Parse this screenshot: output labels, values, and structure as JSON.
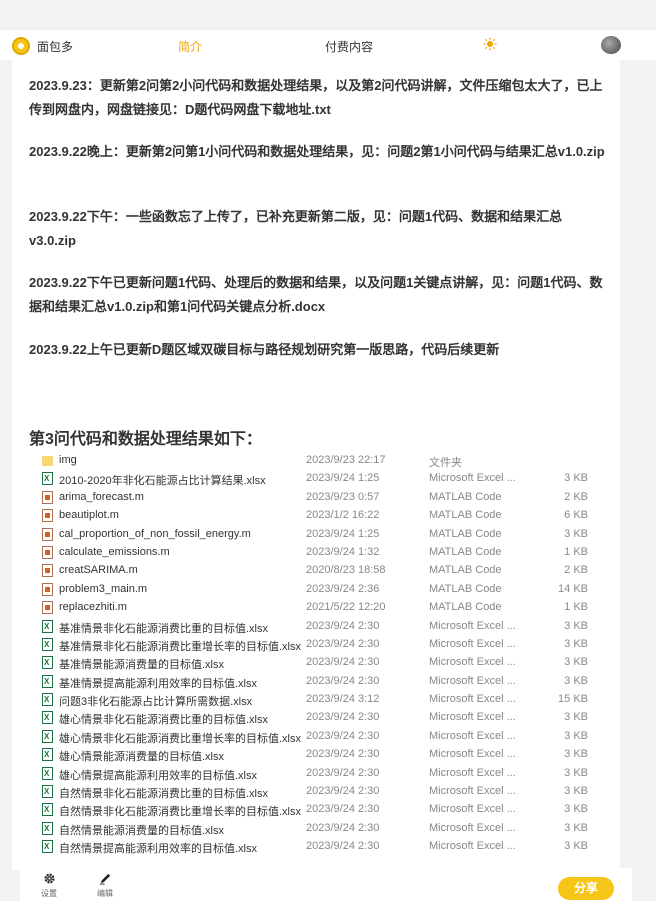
{
  "header": {
    "brand": "面包多",
    "nav_intro": "简介",
    "nav_paid": "付费内容"
  },
  "updates": [
    "2023.9.23：更新第2问第2小问代码和数据处理结果，以及第2问代码讲解，文件压缩包太大了，已上传到网盘内，网盘链接见：D题代码网盘下载地址.txt",
    "2023.9.22晚上：更新第2问第1小问代码和数据处理结果，见：问题2第1小问代码与结果汇总v1.0.zip",
    "2023.9.22下午：一些函数忘了上传了，已补充更新第二版，见：问题1代码、数据和结果汇总v3.0.zip",
    "2023.9.22下午已更新问题1代码、处理后的数据和结果，以及问题1关键点讲解，见：问题1代码、数据和结果汇总v1.0.zip和第1问代码关键点分析.docx",
    "2023.9.22上午已更新D题区域双碳目标与路径规划研究第一版思路，代码后续更新"
  ],
  "section_title": "第3问代码和数据处理结果如下：",
  "files": [
    {
      "name": "img",
      "date": "2023/9/23 22:17",
      "type": "文件夹",
      "size": "",
      "icon": "folder-icon"
    },
    {
      "name": "2010-2020年非化石能源占比计算结果.xlsx",
      "date": "2023/9/24 1:25",
      "type": "Microsoft Excel ...",
      "size": "3 KB",
      "icon": "excel-icon"
    },
    {
      "name": "arima_forecast.m",
      "date": "2023/9/23 0:57",
      "type": "MATLAB Code",
      "size": "2 KB",
      "icon": "matlab-icon"
    },
    {
      "name": "beautiplot.m",
      "date": "2023/1/2 16:22",
      "type": "MATLAB Code",
      "size": "6 KB",
      "icon": "matlab-icon"
    },
    {
      "name": "cal_proportion_of_non_fossil_energy.m",
      "date": "2023/9/24 1:25",
      "type": "MATLAB Code",
      "size": "3 KB",
      "icon": "matlab-icon"
    },
    {
      "name": "calculate_emissions.m",
      "date": "2023/9/24 1:32",
      "type": "MATLAB Code",
      "size": "1 KB",
      "icon": "matlab-icon"
    },
    {
      "name": "creatSARIMA.m",
      "date": "2020/8/23 18:58",
      "type": "MATLAB Code",
      "size": "2 KB",
      "icon": "matlab-icon"
    },
    {
      "name": "problem3_main.m",
      "date": "2023/9/24 2:36",
      "type": "MATLAB Code",
      "size": "14 KB",
      "icon": "matlab-icon"
    },
    {
      "name": "replacezhiti.m",
      "date": "2021/5/22 12:20",
      "type": "MATLAB Code",
      "size": "1 KB",
      "icon": "matlab-icon"
    },
    {
      "name": "基准情景非化石能源消费比重的目标值.xlsx",
      "date": "2023/9/24 2:30",
      "type": "Microsoft Excel ...",
      "size": "3 KB",
      "icon": "excel-icon"
    },
    {
      "name": "基准情景非化石能源消费比重增长率的目标值.xlsx",
      "date": "2023/9/24 2:30",
      "type": "Microsoft Excel ...",
      "size": "3 KB",
      "icon": "excel-icon"
    },
    {
      "name": "基准情景能源消费量的目标值.xlsx",
      "date": "2023/9/24 2:30",
      "type": "Microsoft Excel ...",
      "size": "3 KB",
      "icon": "excel-icon"
    },
    {
      "name": "基准情景提高能源利用效率的目标值.xlsx",
      "date": "2023/9/24 2:30",
      "type": "Microsoft Excel ...",
      "size": "3 KB",
      "icon": "excel-icon"
    },
    {
      "name": "问题3非化石能源占比计算所需数据.xlsx",
      "date": "2023/9/24 3:12",
      "type": "Microsoft Excel ...",
      "size": "15 KB",
      "icon": "excel-icon"
    },
    {
      "name": "雄心情景非化石能源消费比重的目标值.xlsx",
      "date": "2023/9/24 2:30",
      "type": "Microsoft Excel ...",
      "size": "3 KB",
      "icon": "excel-icon"
    },
    {
      "name": "雄心情景非化石能源消费比重增长率的目标值.xlsx",
      "date": "2023/9/24 2:30",
      "type": "Microsoft Excel ...",
      "size": "3 KB",
      "icon": "excel-icon"
    },
    {
      "name": "雄心情景能源消费量的目标值.xlsx",
      "date": "2023/9/24 2:30",
      "type": "Microsoft Excel ...",
      "size": "3 KB",
      "icon": "excel-icon"
    },
    {
      "name": "雄心情景提高能源利用效率的目标值.xlsx",
      "date": "2023/9/24 2:30",
      "type": "Microsoft Excel ...",
      "size": "3 KB",
      "icon": "excel-icon"
    },
    {
      "name": "自然情景非化石能源消费比重的目标值.xlsx",
      "date": "2023/9/24 2:30",
      "type": "Microsoft Excel ...",
      "size": "3 KB",
      "icon": "excel-icon"
    },
    {
      "name": "自然情景非化石能源消费比重增长率的目标值.xlsx",
      "date": "2023/9/24 2:30",
      "type": "Microsoft Excel ...",
      "size": "3 KB",
      "icon": "excel-icon"
    },
    {
      "name": "自然情景能源消费量的目标值.xlsx",
      "date": "2023/9/24 2:30",
      "type": "Microsoft Excel ...",
      "size": "3 KB",
      "icon": "excel-icon"
    },
    {
      "name": "自然情景提高能源利用效率的目标值.xlsx",
      "date": "2023/9/24 2:30",
      "type": "Microsoft Excel ...",
      "size": "3 KB",
      "icon": "excel-icon"
    }
  ],
  "bottom": {
    "settings_label": "设置",
    "edit_label": "编辑",
    "share_label": "分享"
  },
  "colors": {
    "accent": "#f0a500",
    "share_button": "#f5c518"
  }
}
